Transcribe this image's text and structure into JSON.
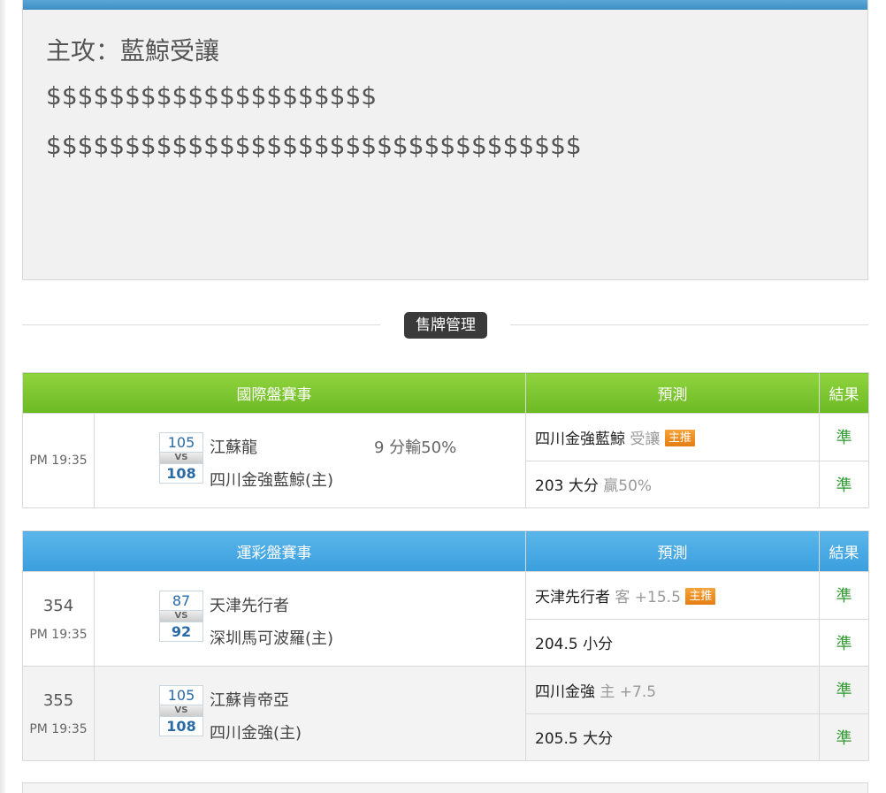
{
  "analysis": {
    "lines": [
      "主攻：藍鯨受讓",
      "$$$$$$$$$$$$$$$$$$$$$",
      "$$$$$$$$$$$$$$$$$$$$$$$$$$$$$$$$$$"
    ]
  },
  "divider": {
    "label": "售牌管理"
  },
  "intl_table": {
    "headers": [
      "國際盤賽事",
      "預測",
      "結果"
    ],
    "games": [
      {
        "number": "",
        "time": "PM 19:35",
        "away_score": "105",
        "home_score": "108",
        "vs": "VS",
        "away_team": "江蘇龍",
        "home_team": "四川金強藍鯨(主)",
        "extra": "9 分輸50%",
        "pred1_main": "四川金強藍鯨",
        "pred1_note": "受讓",
        "pred1_badge": "主推",
        "result1": "準",
        "pred2_main": "203 大分",
        "pred2_note": "贏50%",
        "result2": "準"
      }
    ]
  },
  "sport_table": {
    "headers": [
      "運彩盤賽事",
      "預測",
      "結果"
    ],
    "games": [
      {
        "number": "354",
        "time": "PM 19:35",
        "away_score": "87",
        "home_score": "92",
        "vs": "VS",
        "away_team": "天津先行者",
        "home_team": "深圳馬可波羅(主)",
        "pred1_main": "天津先行者",
        "pred1_note": "客 +15.5",
        "pred1_badge": "主推",
        "result1": "準",
        "pred2_main": "204.5 小分",
        "result2": "準"
      },
      {
        "number": "355",
        "time": "PM 19:35",
        "away_score": "105",
        "home_score": "108",
        "vs": "VS",
        "away_team": "江蘇肯帝亞",
        "home_team": "四川金強(主)",
        "pred1_main": "四川金強",
        "pred1_note": "主 +7.5",
        "result1": "準",
        "pred2_main": "205.5 大分",
        "result2": "準"
      }
    ]
  },
  "colors": {
    "green_header": "#7cc72f",
    "blue_header": "#47a8e3",
    "result_green": "#2f9a2f",
    "badge_orange": "#ee8c22"
  }
}
